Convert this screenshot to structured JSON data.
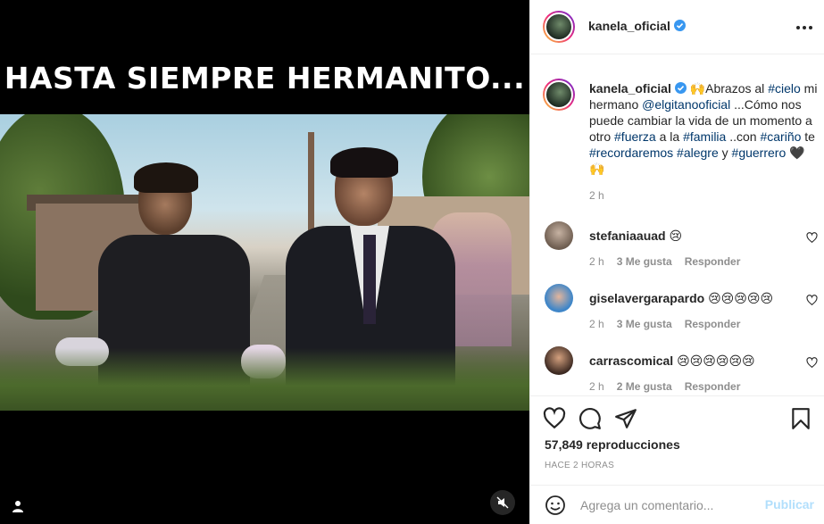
{
  "media": {
    "overlay_text": "HASTA SIEMPRE HERMANITO..."
  },
  "post": {
    "author": "kanela_oficial",
    "caption_parts": [
      {
        "t": "🙌Abrazos al ",
        "tag": false
      },
      {
        "t": "#cielo",
        "tag": true
      },
      {
        "t": " mi hermano ",
        "tag": false
      },
      {
        "t": "@elgitanooficial",
        "tag": true
      },
      {
        "t": " ...Cómo nos puede cambiar la vida de un momento a otro ",
        "tag": false
      },
      {
        "t": "#fuerza",
        "tag": true
      },
      {
        "t": " a la ",
        "tag": false
      },
      {
        "t": "#familia",
        "tag": true
      },
      {
        "t": " ..con ",
        "tag": false
      },
      {
        "t": "#cariño",
        "tag": true
      },
      {
        "t": " te ",
        "tag": false
      },
      {
        "t": "#recordaremos",
        "tag": true
      },
      {
        "t": " ",
        "tag": false
      },
      {
        "t": "#alegre",
        "tag": true
      },
      {
        "t": " y ",
        "tag": false
      },
      {
        "t": "#guerrero",
        "tag": true
      },
      {
        "t": " 🖤🙌",
        "tag": false
      }
    ],
    "caption_time": "2 h",
    "views": "57,849 reproducciones",
    "posted": "HACE 2 HORAS"
  },
  "comments": [
    {
      "user": "stefaniaauad",
      "text": "😢",
      "time": "2 h",
      "likes": "",
      "reply": "Responder",
      "avatar_color": "#8a7a6e"
    },
    {
      "user": "giselavergarapardo",
      "text": "😢😢😢😢😢",
      "time": "2 h",
      "likes": "3 Me gusta",
      "reply": "Responder",
      "avatar_color": "#4a9bd4"
    },
    {
      "user": "carrascomical",
      "text": "😢😢😢😢😢😢",
      "time": "2 h",
      "likes": "2 Me gusta",
      "reply": "Responder",
      "avatar_color": "#6b4a3c"
    }
  ],
  "comment_likes_first": "3 Me gusta",
  "comment_box": {
    "placeholder": "Agrega un comentario...",
    "publish_label": "Publicar"
  },
  "icons": [
    "user-tag-icon",
    "mute-icon",
    "verified-icon",
    "more-icon",
    "heart-icon",
    "comment-icon",
    "share-icon",
    "bookmark-icon",
    "emoji-icon"
  ],
  "colors": {
    "link": "#00376b",
    "muted": "#8e8e8e",
    "verified": "#3897f0",
    "publish_disabled": "#b2dffc"
  }
}
